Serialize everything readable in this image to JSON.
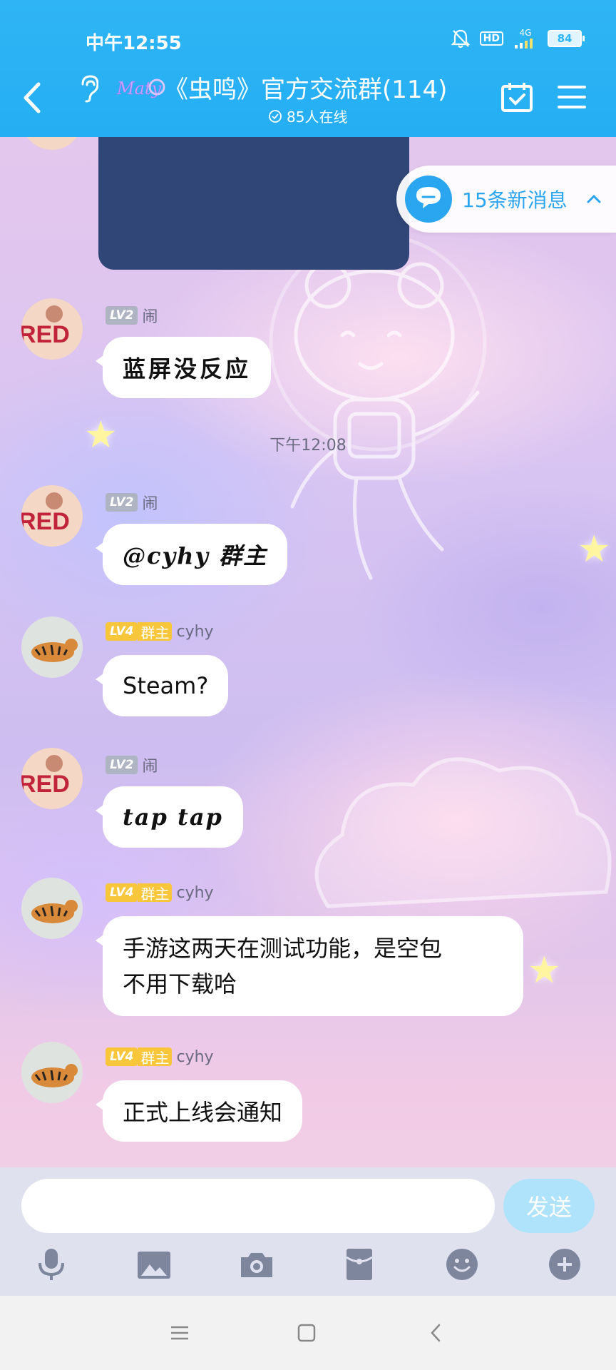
{
  "status_bar": {
    "time": "中午12:55",
    "hd": "HD",
    "network": "4G",
    "battery": "84"
  },
  "header": {
    "logo_text": "Maty",
    "title": "《虫鸣》官方交流群(114)",
    "online": "85人在线"
  },
  "new_messages": {
    "label": "15条新消息"
  },
  "messages": [
    {
      "level": "LV2",
      "name": "闹",
      "text": "蓝屏没反应"
    },
    {
      "level": "LV2",
      "name": "闹",
      "text": "@cyhy 群主"
    },
    {
      "level": "LV4",
      "role": "群主",
      "name": "cyhy",
      "text": "Steam?"
    },
    {
      "level": "LV2",
      "name": "闹",
      "text": "tap tap"
    },
    {
      "level": "LV4",
      "role": "群主",
      "name": "cyhy",
      "text_line1": "手游这两天在测试功能，是空包",
      "text_line2": "不用下载哈"
    },
    {
      "level": "LV4",
      "role": "群主",
      "name": "cyhy",
      "text": "正式上线会通知"
    }
  ],
  "timestamp": "下午12:08",
  "input": {
    "placeholder": "",
    "send_label": "发送"
  },
  "avatar_text": {
    "red": "RED"
  },
  "colors": {
    "header_blue": "#2fb5f5",
    "accent_blue": "#2aa5ef",
    "owner_gold": "#f8c63a"
  },
  "icons": {
    "toolbar": [
      "microphone-icon",
      "image-icon",
      "camera-icon",
      "red-packet-icon",
      "emoji-icon",
      "plus-icon"
    ],
    "nav": [
      "menu-icon",
      "home-square-icon",
      "back-chevron-icon"
    ]
  }
}
